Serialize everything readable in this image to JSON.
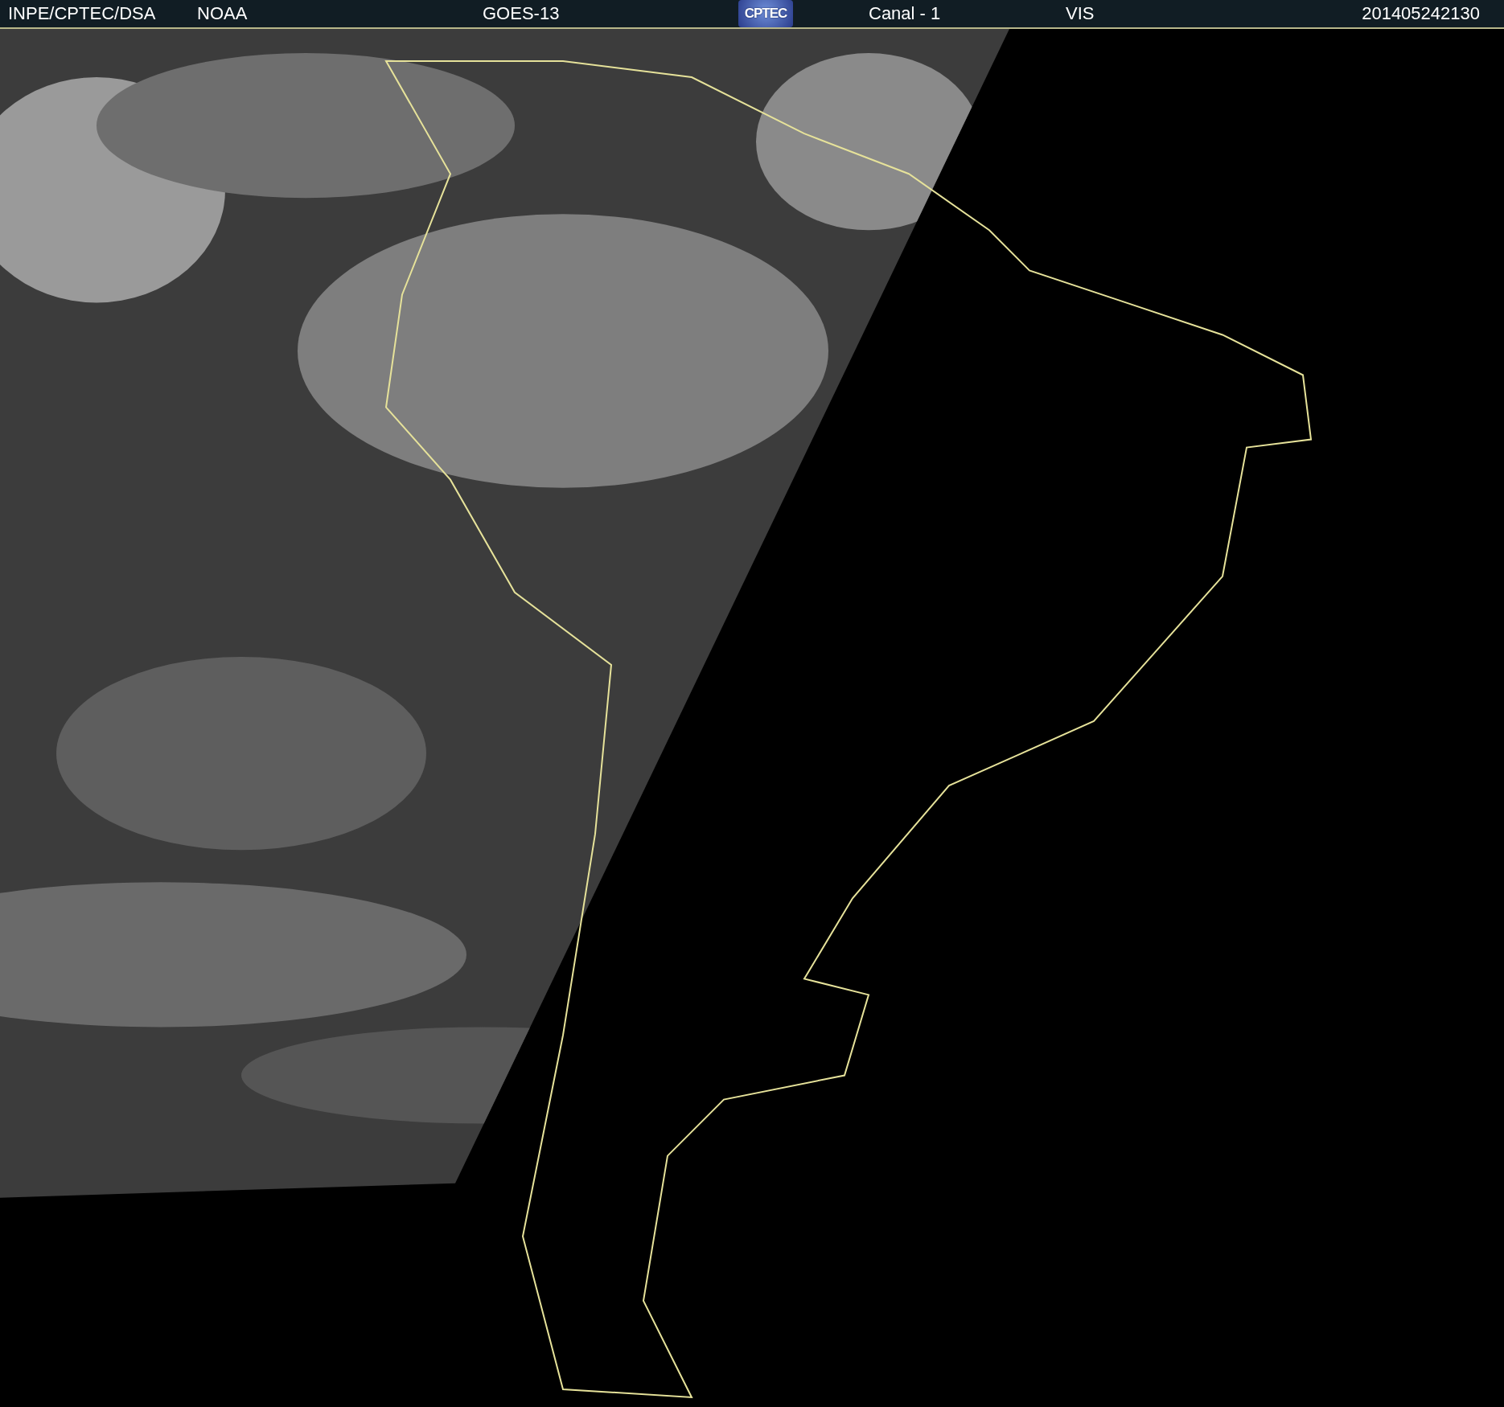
{
  "header": {
    "items": [
      {
        "kind": "text",
        "label": "INPE/CPTEC/DSA"
      },
      {
        "kind": "text",
        "label": "NOAA"
      },
      {
        "kind": "text",
        "label": "GOES-13"
      },
      {
        "kind": "logo",
        "label": "CPTEC"
      },
      {
        "kind": "text",
        "label": "Canal - 1"
      },
      {
        "kind": "text",
        "label": "VIS"
      },
      {
        "kind": "text",
        "label": "201405242130"
      }
    ]
  }
}
